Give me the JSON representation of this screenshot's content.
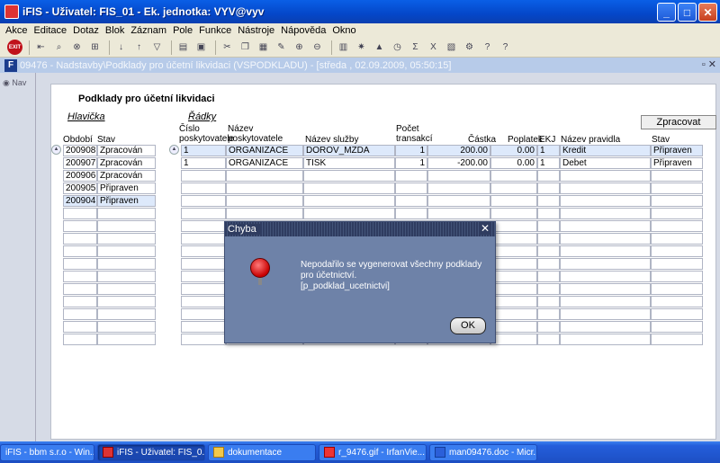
{
  "window": {
    "title": "iFIS - Uživatel: FIS_01 - Ek. jednotka: VYV@vyv"
  },
  "window_buttons": {
    "minimize": "_",
    "maximize": "□",
    "close": "✕"
  },
  "menu": [
    "Akce",
    "Editace",
    "Dotaz",
    "Blok",
    "Záznam",
    "Pole",
    "Funkce",
    "Nástroje",
    "Nápověda",
    "Okno"
  ],
  "toolbar": {
    "exit_label": "EXIT"
  },
  "inner_window": {
    "title": "09476 - Nadstavby\\Podklady pro účetní likvidaci (VSPODKLADU) - [středa , 02.09.2009, 05:50:15]"
  },
  "nav": {
    "label": "Nav"
  },
  "panel": {
    "title": "Podklady pro účetní likvidaci",
    "process_button": "Zpracovat"
  },
  "header_section": {
    "label": "Hlavička",
    "columns": [
      "Období",
      "Stav"
    ],
    "rows": [
      [
        "200908",
        "Zpracován"
      ],
      [
        "200907",
        "Zpracován"
      ],
      [
        "200906",
        "Zpracován"
      ],
      [
        "200905",
        "Připraven"
      ],
      [
        "200904",
        "Připraven"
      ]
    ]
  },
  "lines_section": {
    "label": "Řádky",
    "columns": {
      "cislo": "Číslo poskytovatele",
      "nazev": "Název poskytovatele",
      "sluzba": "Název služby",
      "pocet": "Počet transakcí",
      "castka": "Částka",
      "poplatek": "Poplatek",
      "ekj": "EKJ",
      "pravidlo": "Název pravidla",
      "stav": "Stav"
    },
    "rows": [
      {
        "cislo": "1",
        "nazev": "ORGANIZACE",
        "sluzba": "DOROV_MZDA",
        "pocet": "1",
        "castka": "200.00",
        "poplatek": "0.00",
        "ekj": "1",
        "pravidlo": "Kredit",
        "stav": "Připraven"
      },
      {
        "cislo": "1",
        "nazev": "ORGANIZACE",
        "sluzba": "TISK",
        "pocet": "1",
        "castka": "-200.00",
        "poplatek": "0.00",
        "ekj": "1",
        "pravidlo": "Debet",
        "stav": "Připraven"
      }
    ]
  },
  "dialog": {
    "title": "Chyba",
    "close": "✕",
    "message_line1": "Nepodařilo se vygenerovat všechny podklady pro účetnictví.",
    "message_line2": "[p_podklad_ucetnictvi]",
    "ok_label": "OK"
  },
  "taskbar": [
    {
      "label": "iFIS - bbm s.r.o - Win..."
    },
    {
      "label": "iFIS - Uživatel: FIS_0..."
    },
    {
      "label": "dokumentace"
    },
    {
      "label": "r_9476.gif - IrfanVie..."
    },
    {
      "label": "man09476.doc - Micr..."
    }
  ]
}
